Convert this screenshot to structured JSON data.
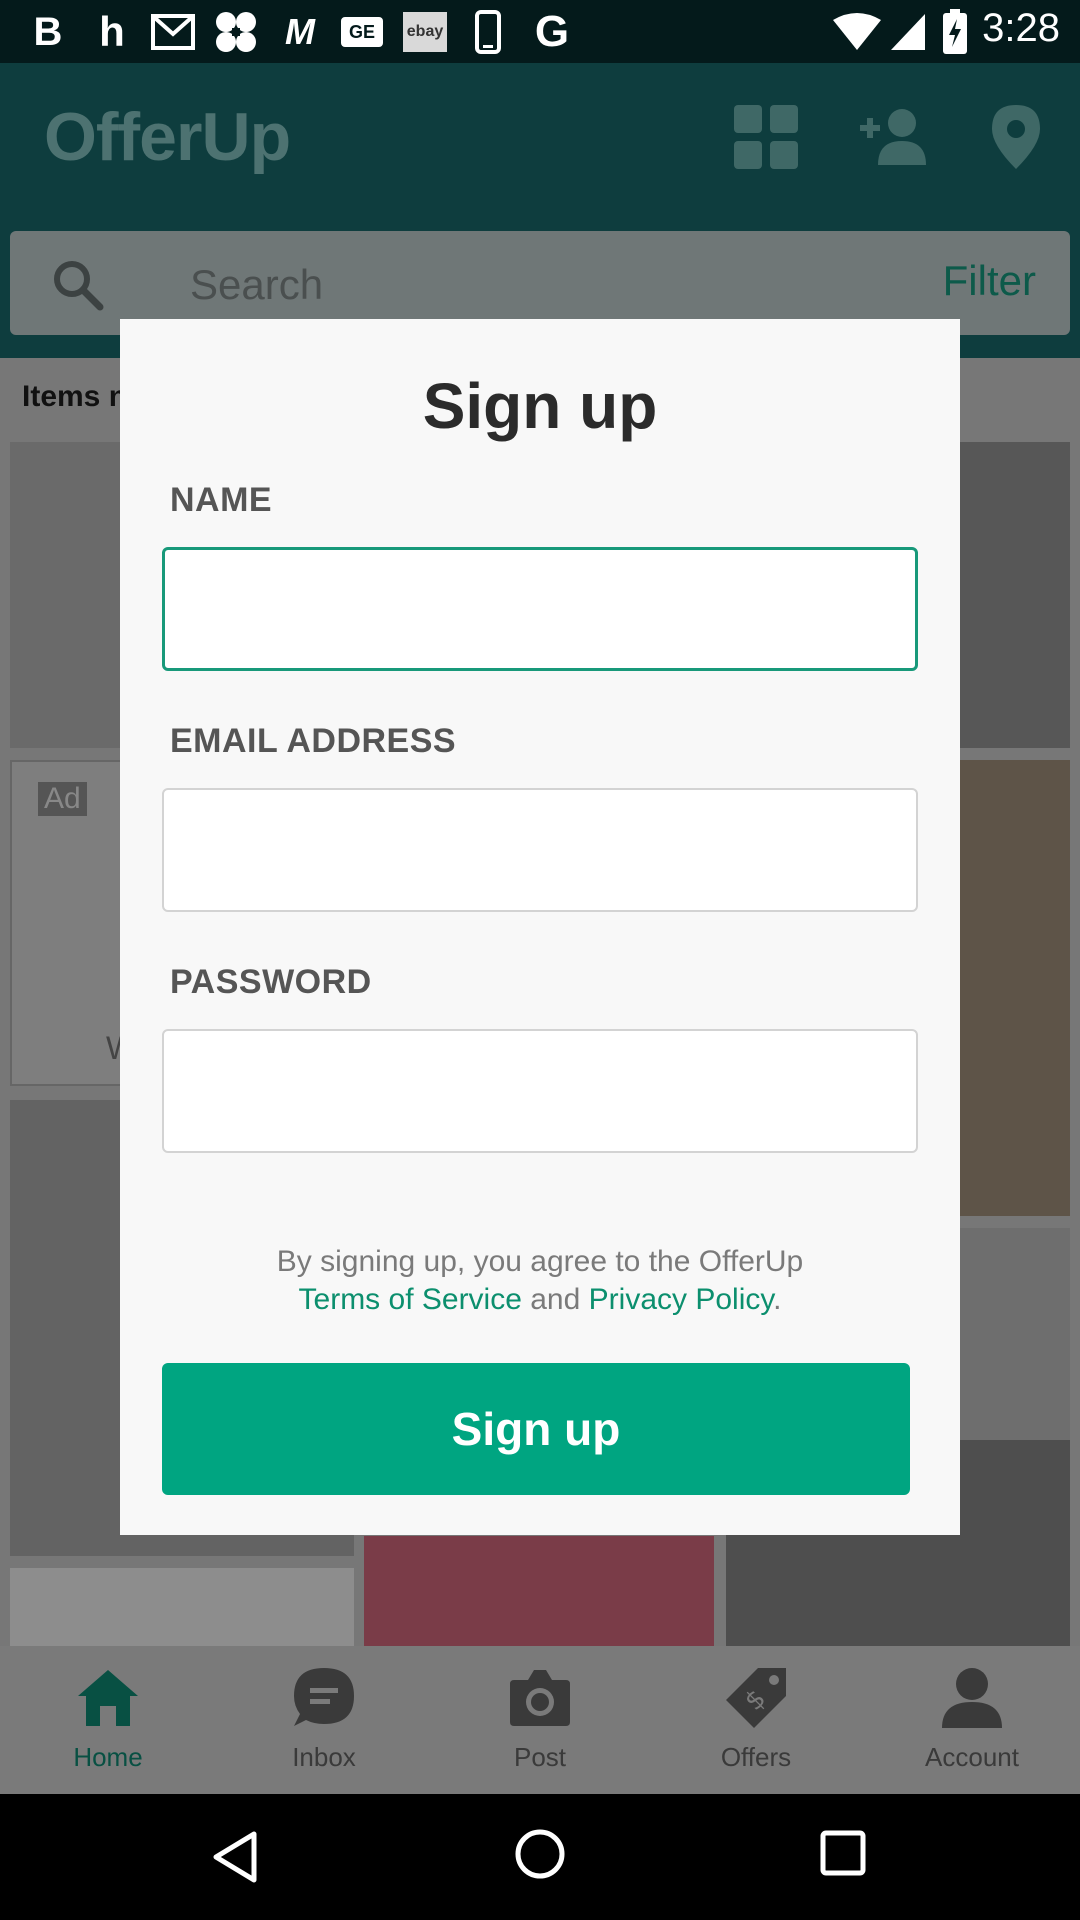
{
  "status_bar": {
    "time": "3:28",
    "notification_icons": [
      "b-icon",
      "h-icon",
      "gmail-icon",
      "puzzle-icon",
      "m-icon",
      "ge-icon",
      "ebay-icon",
      "phone-icon",
      "g-icon"
    ],
    "ebay_label": "ebay",
    "ge_label": "GE"
  },
  "app_bar": {
    "logo": "OfferUp",
    "search_placeholder": "Search",
    "filter_label": "Filter"
  },
  "feed": {
    "section_label": "Items n",
    "ad_badge": "Ad",
    "ad_caption_fragment": "W"
  },
  "modal": {
    "title": "Sign up",
    "name_label": "NAME",
    "name_value": "",
    "email_label": "EMAIL ADDRESS",
    "email_value": "",
    "password_label": "PASSWORD",
    "password_value": "",
    "terms_prefix": "By signing up, you agree to the OfferUp",
    "terms_link": "Terms of Service",
    "terms_and": "and",
    "privacy_link": "Privacy Policy",
    "terms_suffix": ".",
    "submit_label": "Sign up",
    "accent_color": "#00a581"
  },
  "bottom_nav": {
    "items": [
      {
        "label": "Home",
        "icon": "home-icon",
        "active": true
      },
      {
        "label": "Inbox",
        "icon": "chat-icon",
        "active": false
      },
      {
        "label": "Post",
        "icon": "camera-icon",
        "active": false
      },
      {
        "label": "Offers",
        "icon": "price-tag-icon",
        "active": false
      },
      {
        "label": "Account",
        "icon": "person-icon",
        "active": false
      }
    ]
  }
}
